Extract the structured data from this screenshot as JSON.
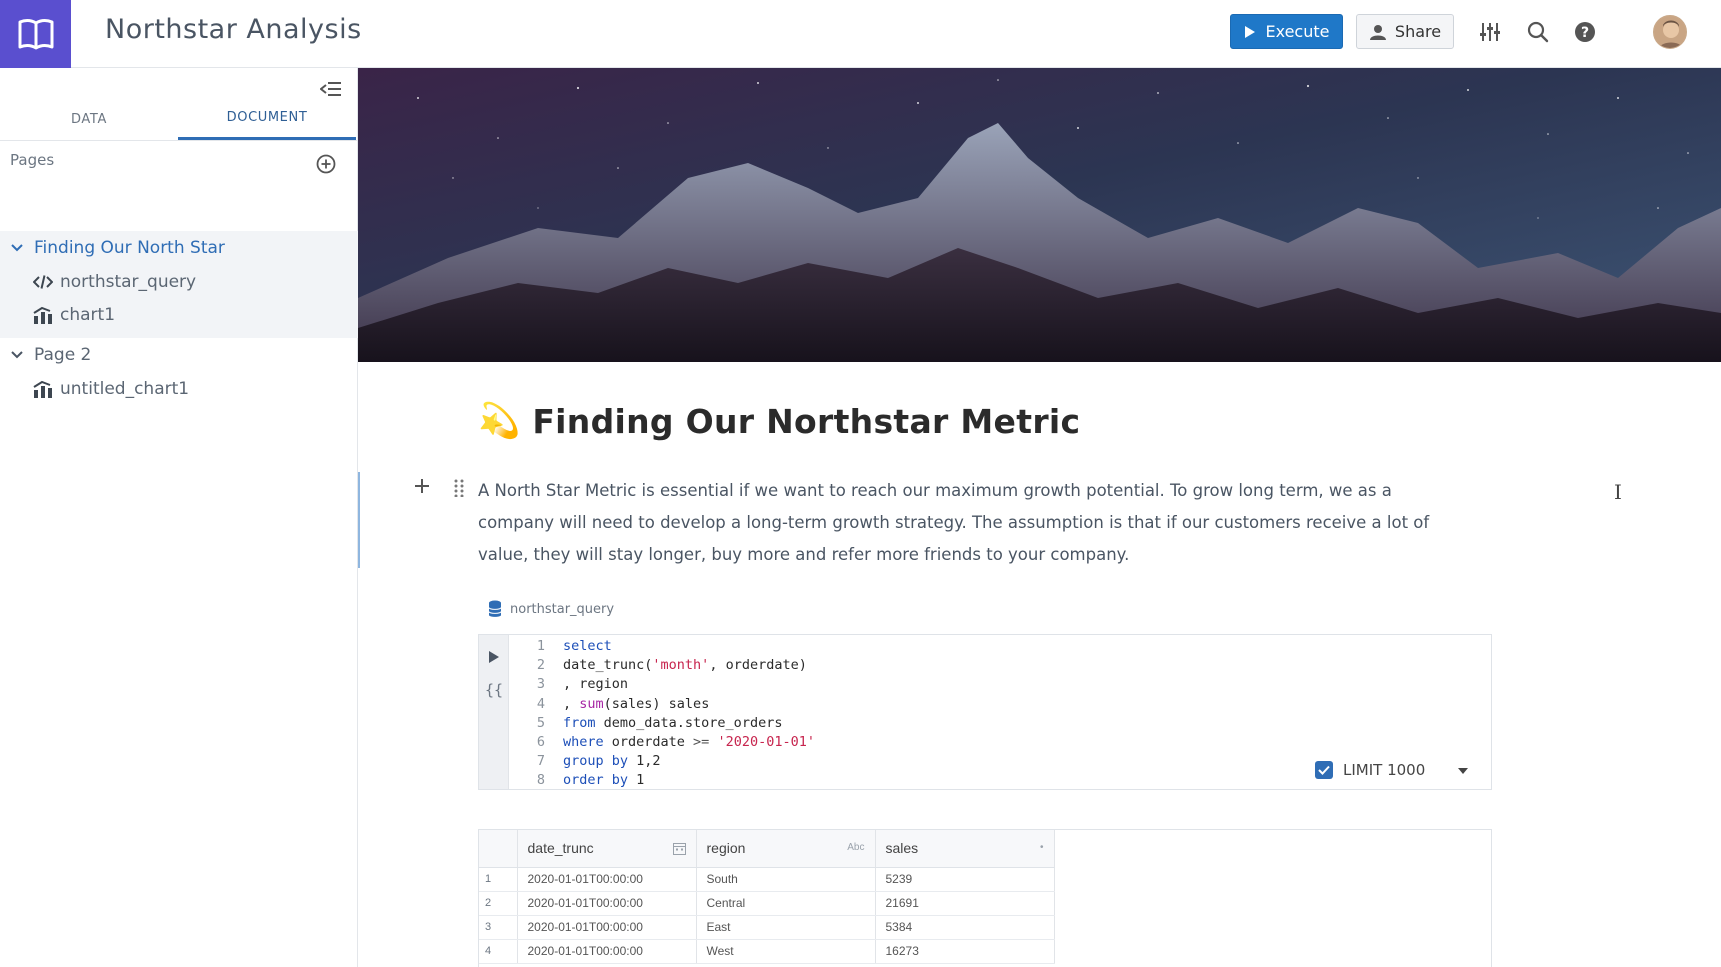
{
  "header": {
    "title": "Northstar Analysis",
    "execute_label": "Execute",
    "share_label": "Share"
  },
  "sidebar": {
    "tabs": [
      "DATA",
      "DOCUMENT"
    ],
    "active_tab": "DOCUMENT",
    "pages_label": "Pages",
    "pages": [
      {
        "title": "Finding Our North Star",
        "expanded": true,
        "active": true,
        "children": [
          {
            "label": "northstar_query",
            "icon": "code-icon"
          },
          {
            "label": "chart1",
            "icon": "chart-icon"
          }
        ]
      },
      {
        "title": "Page 2",
        "expanded": true,
        "active": false,
        "children": [
          {
            "label": "untitled_chart1",
            "icon": "chart-icon"
          }
        ]
      }
    ]
  },
  "document": {
    "title_emoji": "💫",
    "title": "Finding Our Northstar Metric",
    "paragraph_lines": [
      "A North Star Metric is essential if we want to reach our maximum growth potential. To grow long term, we as a",
      "company will need to develop a long-term growth strategy. The assumption is that if our customers receive a lot of",
      "value, they will stay longer, buy more and refer more friends to your company."
    ]
  },
  "query": {
    "name": "northstar_query",
    "line_numbers": [
      "1",
      "2",
      "3",
      "4",
      "5",
      "6",
      "7",
      "8"
    ],
    "limit_label": "LIMIT 1000",
    "limit_enabled": true
  },
  "results": {
    "columns": [
      {
        "name": "date_trunc",
        "type_icon": "calendar-icon"
      },
      {
        "name": "region",
        "type_icon": "Abc"
      },
      {
        "name": "sales",
        "type_icon": "•"
      }
    ],
    "rows": [
      {
        "n": "1",
        "date_trunc": "2020-01-01T00:00:00",
        "region": "South",
        "sales": "5239"
      },
      {
        "n": "2",
        "date_trunc": "2020-01-01T00:00:00",
        "region": "Central",
        "sales": "21691"
      },
      {
        "n": "3",
        "date_trunc": "2020-01-01T00:00:00",
        "region": "East",
        "sales": "5384"
      },
      {
        "n": "4",
        "date_trunc": "2020-01-01T00:00:00",
        "region": "West",
        "sales": "16273"
      }
    ]
  },
  "colors": {
    "brand": "#5a4fcf",
    "primary": "#1f78c8",
    "active_nav": "#2f6db5",
    "keyword": "#1d4fb8",
    "string": "#c7254e"
  }
}
